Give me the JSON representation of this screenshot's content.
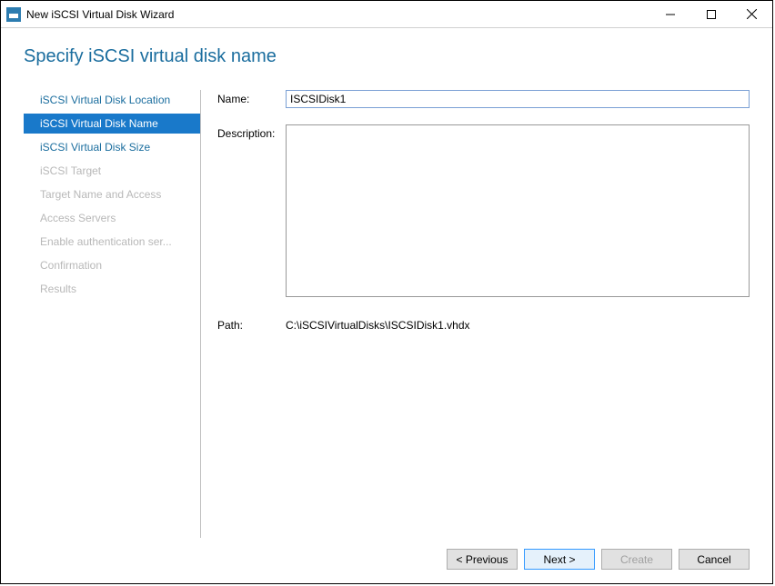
{
  "window": {
    "title": "New iSCSI Virtual Disk Wizard"
  },
  "page": {
    "title": "Specify iSCSI virtual disk name"
  },
  "sidebar": {
    "items": [
      {
        "label": "iSCSI Virtual Disk Location",
        "state": "enabled"
      },
      {
        "label": "iSCSI Virtual Disk Name",
        "state": "selected"
      },
      {
        "label": "iSCSI Virtual Disk Size",
        "state": "enabled"
      },
      {
        "label": "iSCSI Target",
        "state": "disabled"
      },
      {
        "label": "Target Name and Access",
        "state": "disabled"
      },
      {
        "label": "Access Servers",
        "state": "disabled"
      },
      {
        "label": "Enable authentication ser...",
        "state": "disabled"
      },
      {
        "label": "Confirmation",
        "state": "disabled"
      },
      {
        "label": "Results",
        "state": "disabled"
      }
    ]
  },
  "form": {
    "name_label": "Name:",
    "name_value": "ISCSIDisk1",
    "description_label": "Description:",
    "description_value": "",
    "path_label": "Path:",
    "path_value": "C:\\iSCSIVirtualDisks\\ISCSIDisk1.vhdx"
  },
  "buttons": {
    "previous": "< Previous",
    "next": "Next >",
    "create": "Create",
    "cancel": "Cancel"
  }
}
